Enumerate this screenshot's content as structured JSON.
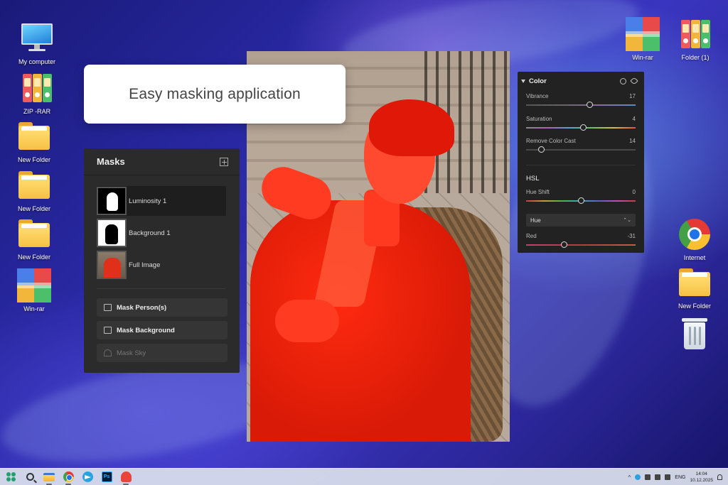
{
  "desktop": {
    "icons_left": [
      {
        "label": "My computer",
        "type": "pc"
      },
      {
        "label": "ZIP -RAR",
        "type": "binders"
      },
      {
        "label": "New Folder",
        "type": "folder"
      },
      {
        "label": "New Folder",
        "type": "folder"
      },
      {
        "label": "New Folder",
        "type": "folder"
      },
      {
        "label": "Win-rar",
        "type": "rar"
      }
    ],
    "icons_right": [
      {
        "label": "Win-rar",
        "type": "rar"
      },
      {
        "label": "Folder (1)",
        "type": "binders"
      },
      {
        "label": "Internet",
        "type": "chrome"
      },
      {
        "label": "New Folder",
        "type": "folder"
      },
      {
        "label": "",
        "type": "trash"
      }
    ]
  },
  "callout": {
    "text": "Easy masking application"
  },
  "masks_panel": {
    "title": "Masks",
    "items": [
      {
        "label": "Luminosity 1",
        "selected": true
      },
      {
        "label": "Background 1",
        "selected": false
      },
      {
        "label": "Full Image",
        "selected": false
      }
    ],
    "buttons": [
      {
        "label": "Mask Person(s)",
        "enabled": true
      },
      {
        "label": "Mask Background",
        "enabled": true
      },
      {
        "label": "Mask Sky",
        "enabled": false
      }
    ]
  },
  "color_panel": {
    "title": "Color",
    "sliders": [
      {
        "label": "Vibrance",
        "value": "17",
        "fraction": 0.58
      },
      {
        "label": "Saturation",
        "value": "4",
        "fraction": 0.52
      },
      {
        "label": "Remove Color Cast",
        "value": "14",
        "fraction": 0.14
      }
    ],
    "hsl": {
      "title": "HSL",
      "hue_shift": {
        "label": "Hue Shift",
        "value": "0",
        "fraction": 0.5
      },
      "select": "Hue",
      "red": {
        "label": "Red",
        "value": "-31",
        "fraction": 0.35
      }
    }
  },
  "taskbar": {
    "tray": {
      "lang": "ENG",
      "time": "14:04",
      "date": "10.12.2025"
    }
  },
  "colors": {
    "accent_red": "#e0301a",
    "panel_bg": "#2b2b2b"
  }
}
